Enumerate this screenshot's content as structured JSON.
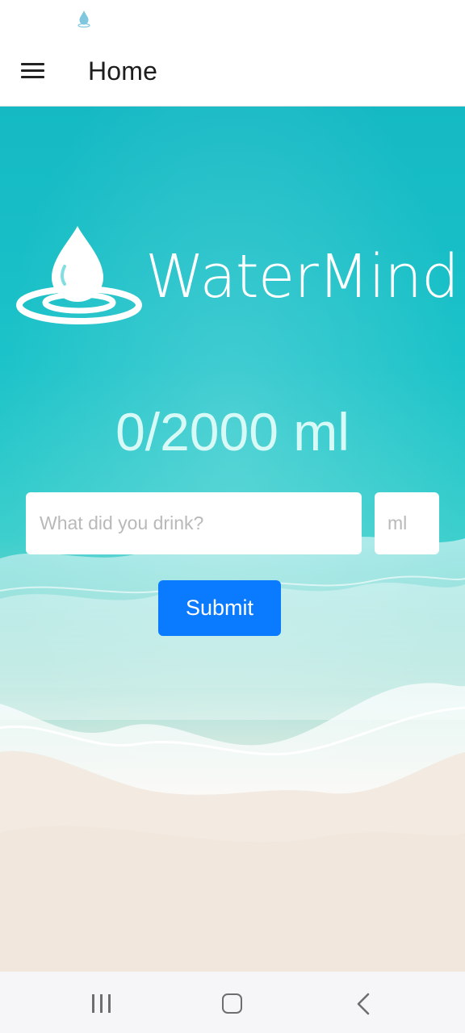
{
  "status_bar": {
    "icon": "water-drop-icon"
  },
  "app_bar": {
    "menu_icon": "hamburger-menu-icon",
    "title": "Home"
  },
  "hero": {
    "logo_icon": "water-drop-ripple-icon",
    "logo_text": "WaterMind",
    "counter_text": "0/2000 ml"
  },
  "form": {
    "drink_placeholder": "What did you drink?",
    "drink_value": "",
    "amount_placeholder": "ml",
    "amount_value": "",
    "submit_label": "Submit"
  },
  "colors": {
    "accent": "#0a7bff",
    "sea": "#1cc3c9",
    "sand": "#f4ede5"
  },
  "nav_bar": {
    "recents_icon": "recent-apps-icon",
    "home_icon": "home-icon",
    "back_icon": "back-icon"
  }
}
